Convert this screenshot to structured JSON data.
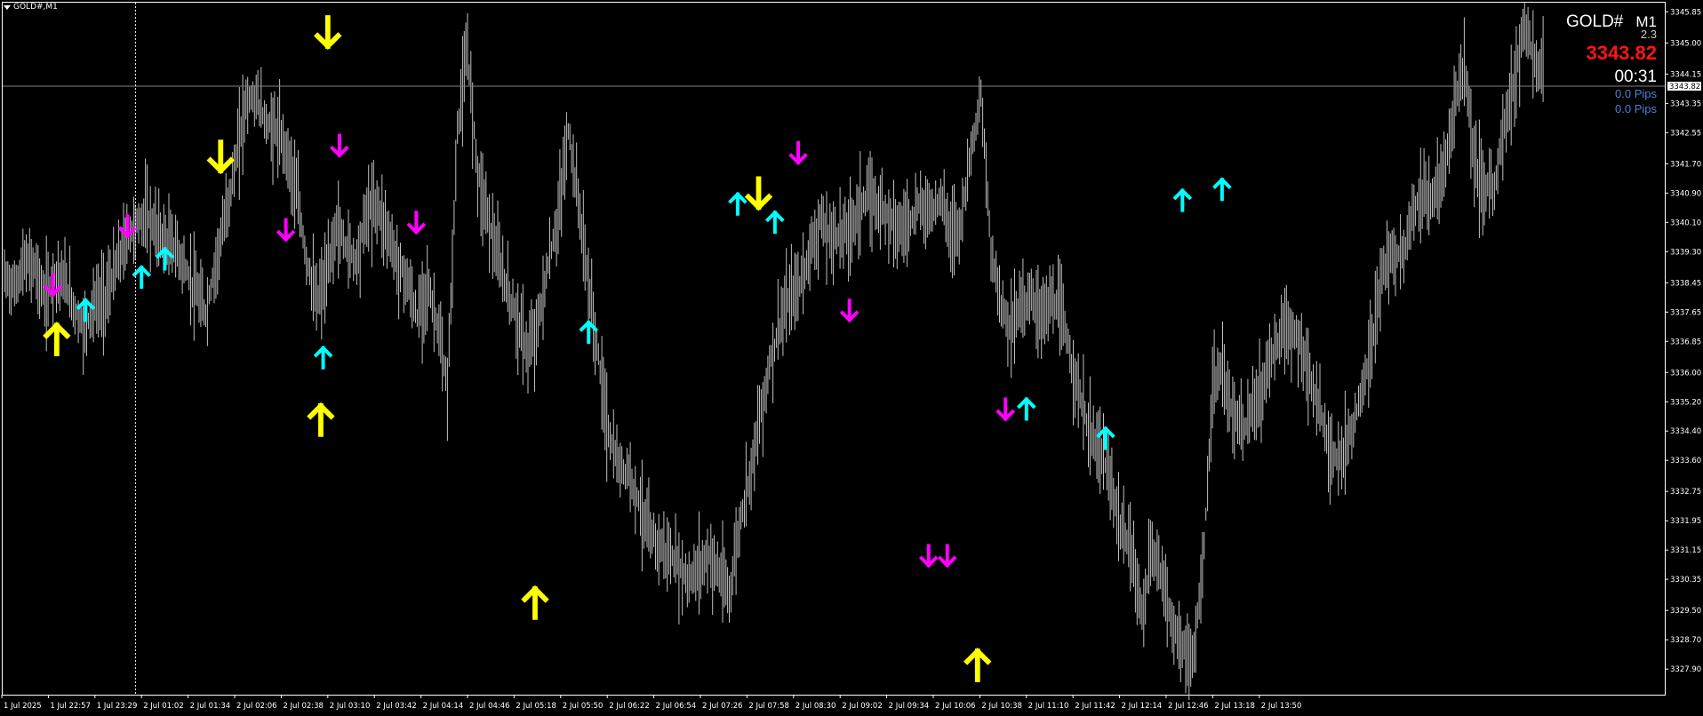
{
  "window": {
    "title": "GOLD#,M1"
  },
  "info_panel": {
    "symbol": "GOLD#",
    "timeframe": "M1",
    "spread": "2.3",
    "price": "3343.82",
    "timer": "00:31",
    "pips_1": "0.0 Pips",
    "pips_2": "0.0 Pips"
  },
  "price_marker": "3343.82",
  "colors": {
    "background": "#000000",
    "candles": "#c0c0c0",
    "price_line": "#808080",
    "axis": "#ffffff",
    "sell_arrow": "#ff00ff",
    "buy_arrow": "#00ffff",
    "strong_buy_sell": "#ffff00",
    "price_text": "#ff1414",
    "pips_text": "#4f7fd8"
  },
  "chart_data": {
    "type": "line",
    "symbol": "GOLD#",
    "timeframe": "M1",
    "ylim": [
      3327.2,
      3346.1
    ],
    "y_ticks": [
      "3345.85",
      "3345.00",
      "3344.15",
      "3343.35",
      "3342.55",
      "3341.70",
      "3340.90",
      "3340.10",
      "3339.30",
      "3338.45",
      "3337.65",
      "3336.85",
      "3336.00",
      "3335.20",
      "3334.40",
      "3333.60",
      "3332.75",
      "3331.95",
      "3331.15",
      "3330.35",
      "3329.50",
      "3328.70",
      "3327.90"
    ],
    "y_tick_values": [
      3345.85,
      3345.0,
      3344.15,
      3343.35,
      3342.55,
      3341.7,
      3340.9,
      3340.1,
      3339.3,
      3338.45,
      3337.65,
      3336.85,
      3336.0,
      3335.2,
      3334.4,
      3333.6,
      3332.75,
      3331.95,
      3331.15,
      3330.35,
      3329.5,
      3328.7,
      3327.9
    ],
    "x_ticks": [
      "1 Jul 2025",
      "1 Jul 22:57",
      "1 Jul 23:29",
      "2 Jul 01:02",
      "2 Jul 01:34",
      "2 Jul 02:06",
      "2 Jul 02:38",
      "2 Jul 03:10",
      "2 Jul 03:42",
      "2 Jul 04:14",
      "2 Jul 04:46",
      "2 Jul 05:18",
      "2 Jul 05:50",
      "2 Jul 06:22",
      "2 Jul 06:54",
      "2 Jul 07:26",
      "2 Jul 07:58",
      "2 Jul 08:30",
      "2 Jul 09:02",
      "2 Jul 09:34",
      "2 Jul 10:06",
      "2 Jul 10:38",
      "2 Jul 11:10",
      "2 Jul 11:42",
      "2 Jul 12:14",
      "2 Jul 12:46",
      "2 Jul 13:18",
      "2 Jul 13:50"
    ],
    "current_price": 3343.82,
    "separator_after_tick": 2,
    "series": [
      {
        "values": [
          3338.6,
          3338.3,
          3339.0,
          3338.9,
          3338.0,
          3338.7,
          3338.5,
          3337.7,
          3337.2,
          3337.9,
          3338.0,
          3338.8,
          3339.6,
          3340.0,
          3340.3,
          3339.9,
          3339.6,
          3339.4,
          3338.8,
          3338.2,
          3337.6,
          3339.0,
          3340.3,
          3341.8,
          3343.4,
          3343.5,
          3342.8,
          3342.6,
          3342.1,
          3340.9,
          3339.1,
          3337.9,
          3338.6,
          3340.0,
          3339.4,
          3339.1,
          3340.4,
          3340.6,
          3339.9,
          3339.0,
          3338.5,
          3337.5,
          3338.4,
          3337.3,
          3335.5,
          3342.6,
          3344.8,
          3341.5,
          3340.3,
          3339.1,
          3338.2,
          3337.4,
          3336.5,
          3337.3,
          3338.9,
          3340.2,
          3342.6,
          3340.7,
          3338.4,
          3336.4,
          3334.3,
          3333.4,
          3333.3,
          3332.5,
          3331.6,
          3331.3,
          3331.0,
          3330.7,
          3330.3,
          3330.7,
          3331.0,
          3330.5,
          3329.9,
          3331.8,
          3333.2,
          3334.7,
          3336.2,
          3337.3,
          3338.0,
          3338.4,
          3339.3,
          3340.1,
          3339.7,
          3339.8,
          3339.9,
          3340.6,
          3340.8,
          3340.5,
          3340.3,
          3339.9,
          3340.2,
          3340.6,
          3340.4,
          3340.8,
          3339.8,
          3340.1,
          3342.1,
          3343.5,
          3339.3,
          3337.9,
          3337.2,
          3337.9,
          3338.0,
          3337.6,
          3337.9,
          3337.6,
          3336.3,
          3335.1,
          3334.2,
          3333.8,
          3332.8,
          3331.6,
          3331.1,
          3329.4,
          3331.1,
          3330.5,
          3329.1,
          3328.5,
          3328.0,
          3330.5,
          3335.4,
          3336.1,
          3334.8,
          3334.4,
          3334.9,
          3335.6,
          3336.6,
          3337.1,
          3337.1,
          3336.6,
          3335.5,
          3334.6,
          3333.7,
          3333.8,
          3334.6,
          3335.6,
          3337.0,
          3338.9,
          3339.2,
          3339.3,
          3340.5,
          3340.9,
          3340.7,
          3341.6,
          3343.2,
          3344.5,
          3341.7,
          3341.0,
          3341.1,
          3342.7,
          3344.1,
          3345.4,
          3344.5,
          3344.0
        ]
      }
    ],
    "signals": [
      {
        "type": "sell",
        "price": 3339.2,
        "x_tick": 0,
        "offset": -0.9
      },
      {
        "type": "sell",
        "price": 3338.4,
        "x_tick": 1,
        "offset": 0.1
      },
      {
        "type": "strong_buy",
        "price": 3336.9,
        "x_tick": 1,
        "offset": 0.18
      },
      {
        "type": "buy",
        "price": 3337.7,
        "x_tick": 1,
        "offset": 0.8
      },
      {
        "type": "sell",
        "price": 3340.0,
        "x_tick": 2,
        "offset": 0.7
      },
      {
        "type": "buy",
        "price": 3338.6,
        "x_tick": 3,
        "offset": 0.0
      },
      {
        "type": "buy",
        "price": 3339.1,
        "x_tick": 3,
        "offset": 0.5
      },
      {
        "type": "strong_sell",
        "price": 3341.9,
        "x_tick": 4,
        "offset": 0.7
      },
      {
        "type": "sell",
        "price": 3339.9,
        "x_tick": 6,
        "offset": 0.1
      },
      {
        "type": "buy",
        "price": 3336.4,
        "x_tick": 6,
        "offset": 0.9
      },
      {
        "type": "strong_buy",
        "price": 3334.7,
        "x_tick": 6,
        "offset": 0.85
      },
      {
        "type": "strong_sell",
        "price": 3345.3,
        "x_tick": 6,
        "offset": 1.0
      },
      {
        "type": "sell",
        "price": 3342.2,
        "x_tick": 7,
        "offset": 0.25
      },
      {
        "type": "sell",
        "price": 3340.1,
        "x_tick": 8,
        "offset": 0.9
      },
      {
        "type": "strong_buy",
        "price": 3329.7,
        "x_tick": 11,
        "offset": 0.45
      },
      {
        "type": "buy",
        "price": 3337.1,
        "x_tick": 12,
        "offset": 0.6
      },
      {
        "type": "buy",
        "price": 3340.6,
        "x_tick": 15,
        "offset": 0.8
      },
      {
        "type": "strong_sell",
        "price": 3340.9,
        "x_tick": 16,
        "offset": 0.25
      },
      {
        "type": "buy",
        "price": 3340.1,
        "x_tick": 16,
        "offset": 0.6
      },
      {
        "type": "sell",
        "price": 3342.0,
        "x_tick": 17,
        "offset": 0.1
      },
      {
        "type": "sell",
        "price": 3337.7,
        "x_tick": 18,
        "offset": 0.2
      },
      {
        "type": "sell",
        "price": 3331.0,
        "x_tick": 19,
        "offset": 0.9
      },
      {
        "type": "sell",
        "price": 3331.0,
        "x_tick": 20,
        "offset": 0.3
      },
      {
        "type": "strong_buy",
        "price": 3328.0,
        "x_tick": 20,
        "offset": 0.95
      },
      {
        "type": "sell",
        "price": 3335.0,
        "x_tick": 21,
        "offset": 0.55
      },
      {
        "type": "buy",
        "price": 3335.0,
        "x_tick": 22,
        "offset": 0.0
      },
      {
        "type": "buy",
        "price": 3334.2,
        "x_tick": 23,
        "offset": 0.7
      },
      {
        "type": "buy",
        "price": 3340.7,
        "x_tick": 25,
        "offset": 0.35
      },
      {
        "type": "buy",
        "price": 3341.0,
        "x_tick": 26,
        "offset": 0.2
      }
    ]
  }
}
